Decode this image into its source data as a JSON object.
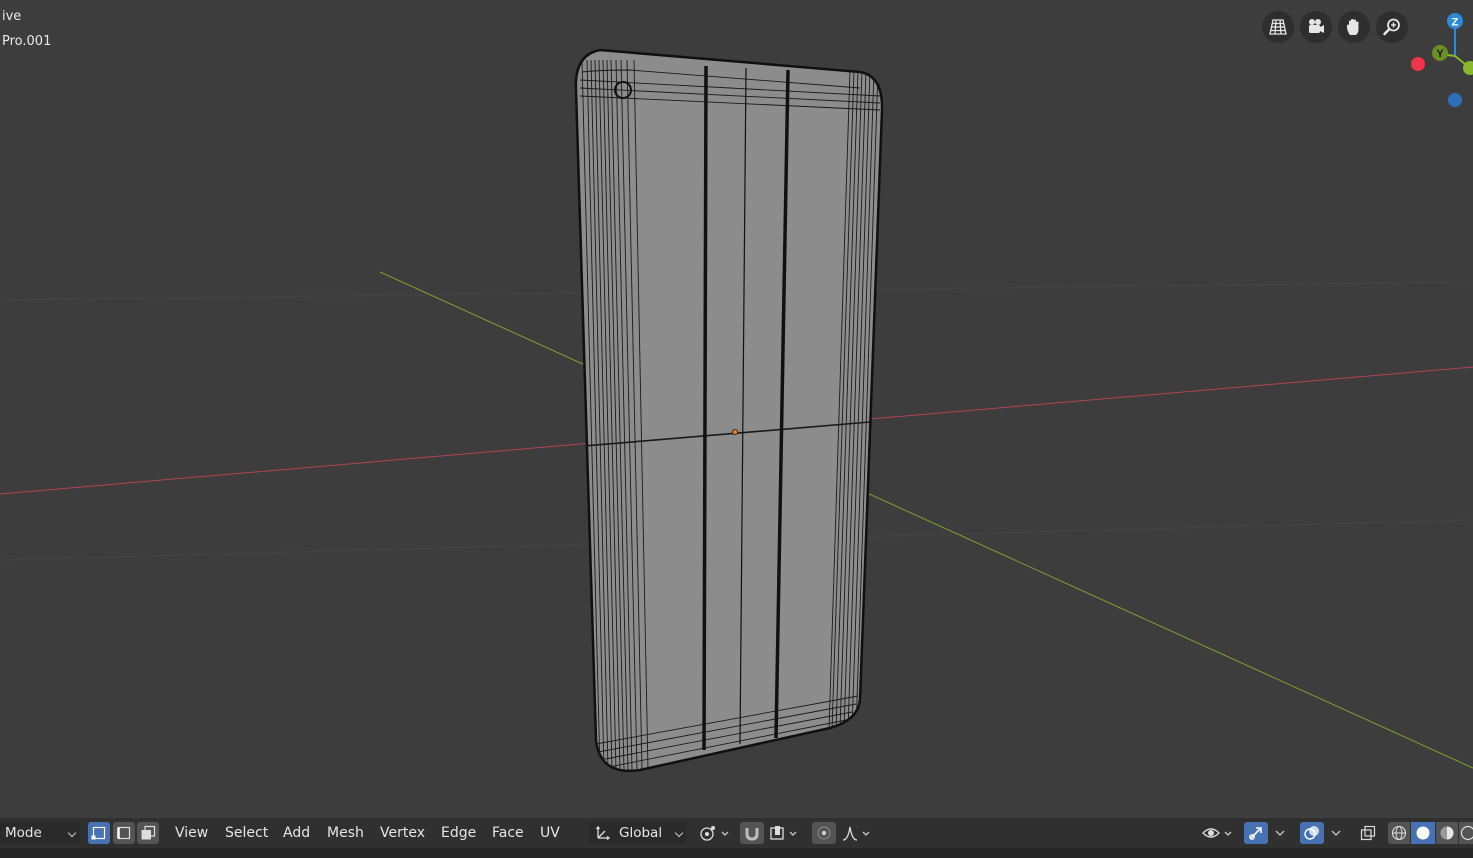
{
  "viewport": {
    "mode_text_partial": "ive",
    "object_name_partial": "Pro.001"
  },
  "navigation": {
    "icons": [
      "grid-perspective-icon",
      "camera-icon",
      "hand-pan-icon",
      "zoom-icon"
    ]
  },
  "gizmo": {
    "z_label": "Z",
    "y_label": "Y",
    "colors": {
      "x": "#f0334b",
      "y": "#8ab82e",
      "z": "#2c8bd9"
    }
  },
  "header": {
    "mode_label": "Mode",
    "menus": {
      "view": "View",
      "select": "Select",
      "add": "Add",
      "mesh": "Mesh",
      "vertex": "Vertex",
      "edge": "Edge",
      "face": "Face",
      "uv": "UV"
    },
    "orientation_label": "Global"
  },
  "colors": {
    "background": "#3d3d3d",
    "header": "#303030",
    "accent": "#4772b3",
    "x_axis": "#b0444e",
    "y_axis": "#7da32c"
  }
}
